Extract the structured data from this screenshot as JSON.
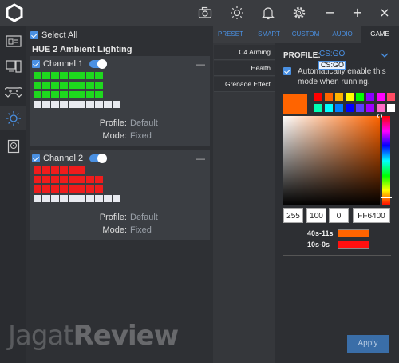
{
  "top_icons": [
    "camera-icon",
    "brightness-icon",
    "bell-icon",
    "gear-icon"
  ],
  "window": {
    "minimize": "−",
    "maximize": "+",
    "close": "×"
  },
  "nav": [
    "device-icon",
    "pc-icon",
    "gamepad-icon",
    "lighting-icon",
    "storage-icon"
  ],
  "center": {
    "select_all": "Select All",
    "device_title": "HUE 2 Ambient Lighting",
    "channels": [
      {
        "label": "Channel 1",
        "profile_key": "Profile:",
        "profile_val": "Default",
        "mode_key": "Mode:",
        "mode_val": "Fixed",
        "led_color": "#1ed81e",
        "rows": [
          8,
          8,
          8,
          10
        ]
      },
      {
        "label": "Channel 2",
        "profile_key": "Profile:",
        "profile_val": "Default",
        "mode_key": "Mode:",
        "mode_val": "Fixed",
        "led_color": "#ef1c1c",
        "rows": [
          6,
          8,
          8,
          10
        ]
      }
    ]
  },
  "tabs": [
    "PRESET",
    "SMART",
    "CUSTOM",
    "AUDIO",
    "GAME"
  ],
  "active_tab": "GAME",
  "effects": [
    "C4 Arming",
    "Health",
    "Grenade Effect"
  ],
  "right": {
    "profile_label": "PROFILE:",
    "profile_value": "CS:GO",
    "dropdown_option": "CS:GO",
    "auto_enable_text": "Automatically enable this mode when running.",
    "current_color": "#ff6400",
    "preset_colors": [
      "#ff0000",
      "#ff6400",
      "#ffb400",
      "#ffff00",
      "#00ff00",
      "#8c00ff",
      "#ff00ff",
      "#ff4b64",
      "#00ffb4",
      "#00ffff",
      "#0080ff",
      "#0000ff",
      "#5a3cff",
      "#a000ff",
      "#ff6ec8",
      "#ffffff"
    ],
    "rgb": {
      "r": "255",
      "g": "100",
      "b": "0",
      "hex": "FF6400"
    },
    "legend": [
      {
        "label": "40s-11s",
        "color": "#ff6400"
      },
      {
        "label": "10s-0s",
        "color": "#ff1010"
      }
    ],
    "apply": "Apply"
  },
  "watermark": {
    "part1": "Jagat",
    "part2": "Review"
  }
}
